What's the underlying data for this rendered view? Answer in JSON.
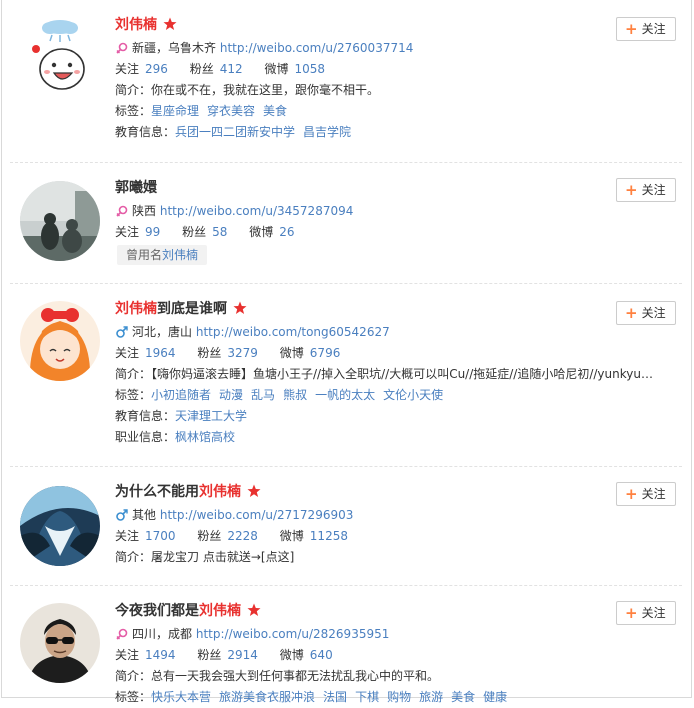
{
  "follow_label": "关注",
  "labels": {
    "following": "关注",
    "fans": "粉丝",
    "posts": "微博",
    "bio": "简介：",
    "tags": "标签：",
    "edu": "教育信息：",
    "job": "职业信息：",
    "used_name": "曾用名"
  },
  "users": [
    {
      "name_parts": [
        {
          "t": "刘伟楠",
          "hl": true
        }
      ],
      "verified": true,
      "gender": "female",
      "location": "新疆，乌鲁木齐",
      "url": "http://weibo.com/u/2760037714",
      "following": "296",
      "fans": "412",
      "posts": "1058",
      "bio": "你在或不在，我就在这里，跟你毫不相干。",
      "tags": [
        "星座命理",
        "穿衣美容",
        "美食"
      ],
      "edu": [
        "兵团一四二团新安中学",
        "昌吉学院"
      ]
    },
    {
      "name_parts": [
        {
          "t": "郭曦嬛",
          "hl": false
        }
      ],
      "verified": false,
      "gender": "female",
      "location": "陕西",
      "url": "http://weibo.com/u/3457287094",
      "following": "99",
      "fans": "58",
      "posts": "26",
      "used_name": "刘伟楠"
    },
    {
      "name_parts": [
        {
          "t": "刘伟楠",
          "hl": true
        },
        {
          "t": "到底是谁啊",
          "hl": false
        }
      ],
      "verified": true,
      "gender": "male",
      "location": "河北，唐山",
      "url": "http://weibo.com/tong60542627",
      "following": "1964",
      "fans": "3279",
      "posts": "6796",
      "bio": "【嗨你妈逼滚去睡】鱼塘小王子//掉入全职坑//大概可以叫Cu//拖延症//追随小哈尼初//yunkyu…",
      "tags": [
        "小初追随者",
        "动漫",
        "乱马",
        "熊叔",
        "一帆的太太",
        "文伦小天使"
      ],
      "edu": [
        "天津理工大学"
      ],
      "job": [
        "枫林馆高校"
      ]
    },
    {
      "name_parts": [
        {
          "t": "为什么不能用",
          "hl": false
        },
        {
          "t": "刘伟楠",
          "hl": true
        }
      ],
      "verified": true,
      "gender": "male",
      "location": "其他",
      "url": "http://weibo.com/u/2717296903",
      "following": "1700",
      "fans": "2228",
      "posts": "11258",
      "bio": "屠龙宝刀 点击就送→[点这]"
    },
    {
      "name_parts": [
        {
          "t": "今夜我们都是",
          "hl": false
        },
        {
          "t": "刘伟楠",
          "hl": true
        }
      ],
      "verified": true,
      "gender": "female",
      "location": "四川，成都",
      "url": "http://weibo.com/u/2826935951",
      "following": "1494",
      "fans": "2914",
      "posts": "640",
      "bio": "总有一天我会强大到任何事都无法扰乱我心中的平和。",
      "tags": [
        "快乐大本营",
        "旅游美食衣服冲浪",
        "法国",
        "下棋",
        "购物",
        "旅游",
        "美食",
        "健康"
      ]
    }
  ]
}
